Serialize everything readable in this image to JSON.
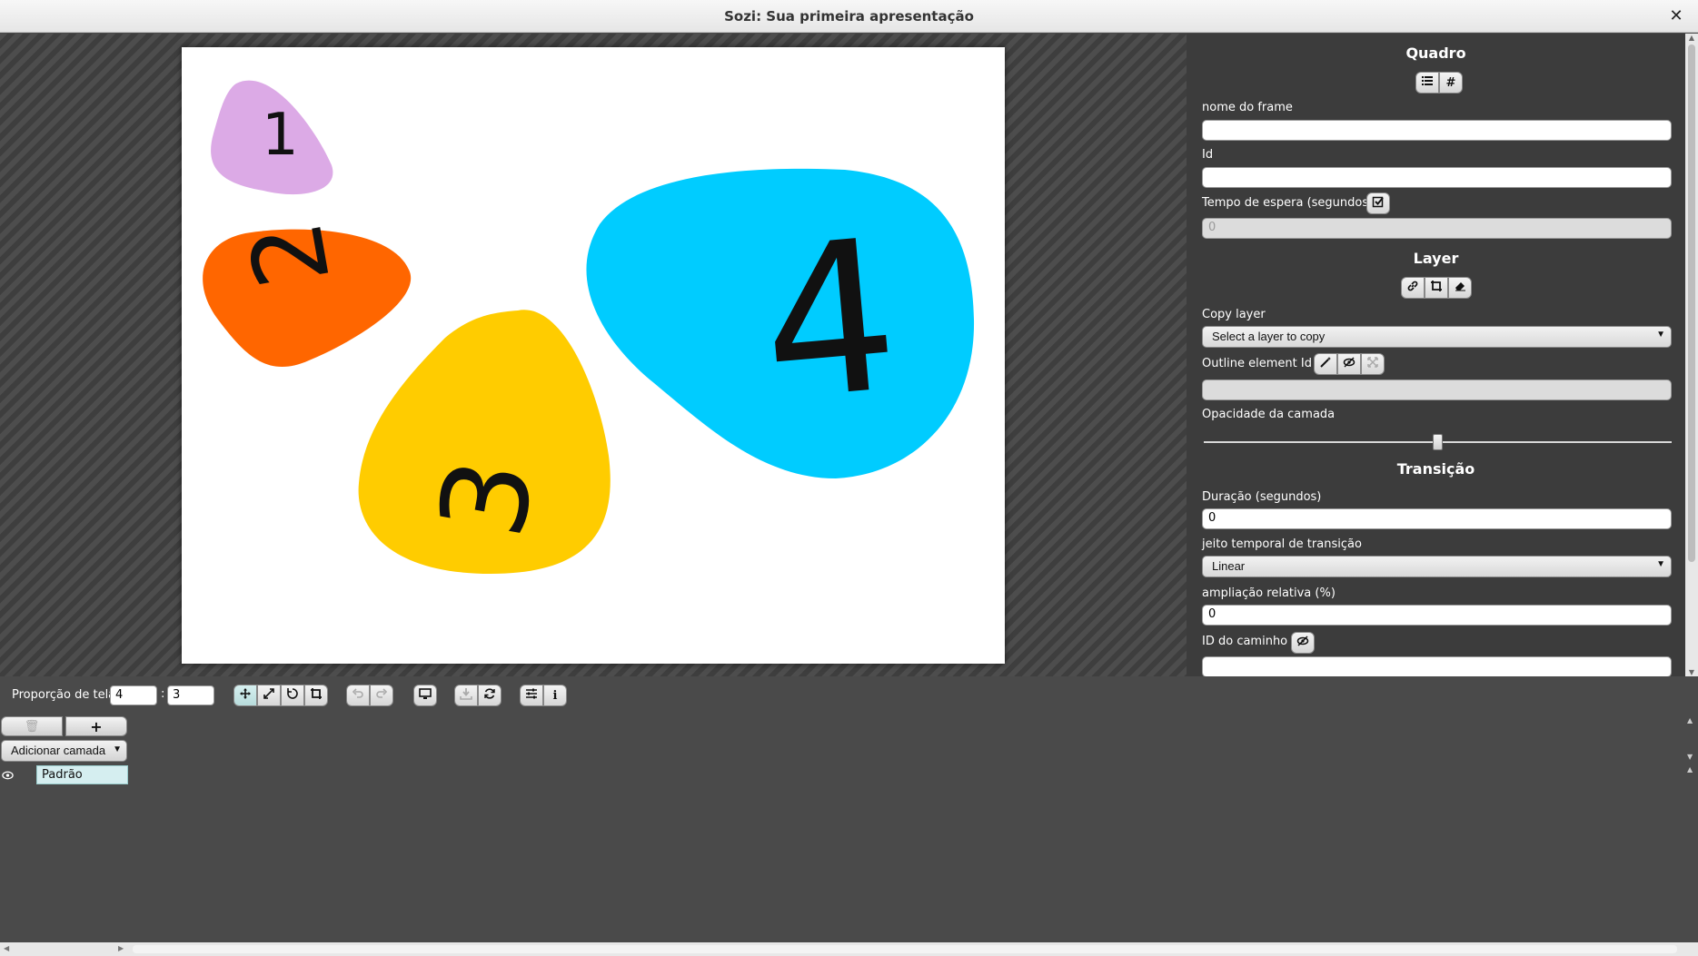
{
  "window": {
    "title": "Sozi: Sua primeira apresentação",
    "close_glyph": "✕"
  },
  "slide": {
    "shapes": [
      {
        "label": "1",
        "color": "#dcaae6"
      },
      {
        "label": "2",
        "color": "#ff6600"
      },
      {
        "label": "3",
        "color": "#ffcc00"
      },
      {
        "label": "4",
        "color": "#00ccff"
      }
    ]
  },
  "properties": {
    "frame": {
      "title": "Quadro",
      "name_label": "nome do frame",
      "name_value": "",
      "id_label": "Id",
      "id_value": "",
      "timeout_label": "Tempo de espera (segundos)",
      "timeout_value": "0",
      "buttons": [
        "list-icon",
        "hash-icon"
      ]
    },
    "layer": {
      "title": "Layer",
      "copy_label": "Copy layer",
      "copy_placeholder": "Select a layer to copy",
      "outline_label": "Outline element Id",
      "outline_value": "",
      "opacity_label": "Opacidade da camada",
      "opacity_value": 0.5,
      "buttons": [
        "link-icon",
        "crop-icon",
        "eraser-icon"
      ]
    },
    "transition": {
      "title": "Transição",
      "duration_label": "Duração (segundos)",
      "duration_value": "0",
      "timing_label": "jeito temporal de transição",
      "timing_value": "Linear",
      "zoom_label": "ampliação relativa (%)",
      "zoom_value": "0",
      "path_label": "ID do caminho",
      "path_value": ""
    }
  },
  "toolbar": {
    "aspect_label": "Proporção de tela",
    "aspect_w": "4",
    "aspect_h": "3",
    "aspect_sep": ":"
  },
  "timeline": {
    "delete_glyph": "🗑",
    "add_glyph": "+",
    "add_layer_label": "Adicionar camada",
    "layers": [
      {
        "name": "Padrão",
        "visible": true
      }
    ]
  },
  "colors": {
    "accent_active": "#b8dcdc",
    "panel_bg": "#3c3c3c",
    "workspace_bg": "#4a4a4a"
  }
}
